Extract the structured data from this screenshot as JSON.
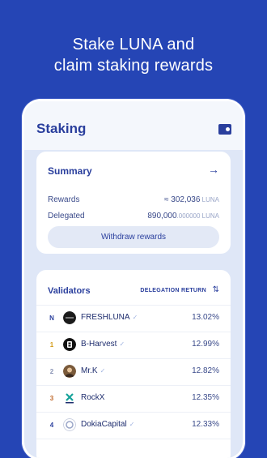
{
  "headline": {
    "line1": "Stake LUNA and",
    "line2": "claim staking rewards"
  },
  "header": {
    "title": "Staking",
    "wallet_icon": "wallet-icon"
  },
  "summary": {
    "title": "Summary",
    "rewards_label": "Rewards",
    "rewards_prefix": "≈ ",
    "rewards_value": "302,036",
    "rewards_unit": " LUNA",
    "delegated_label": "Delegated",
    "delegated_value": "890,000",
    "delegated_decimals": ".000000",
    "delegated_unit": " LUNA",
    "withdraw_label": "Withdraw rewards"
  },
  "validators": {
    "title": "Validators",
    "sort_label": "DELEGATION RETURN",
    "sort_icon": "sort-icon",
    "rows": [
      {
        "rank": "N",
        "name": "FRESHLUNA",
        "rate": "13.02%",
        "rank_color": "#2a3f9d"
      },
      {
        "rank": "1",
        "name": "B-Harvest",
        "rate": "12.99%",
        "rank_color": "#d39b19"
      },
      {
        "rank": "2",
        "name": "Mr.K",
        "rate": "12.82%",
        "rank_color": "#8a94b5"
      },
      {
        "rank": "3",
        "name": "RockX",
        "rate": "12.35%",
        "rank_color": "#c0692c"
      },
      {
        "rank": "4",
        "name": "DokiaCapital",
        "rate": "12.33%",
        "rank_color": "#2a3f9d"
      }
    ]
  },
  "colors": {
    "background": "#2545b5",
    "primary": "#2a3f9d",
    "card": "#ffffff",
    "panel": "#dfe7f7"
  }
}
